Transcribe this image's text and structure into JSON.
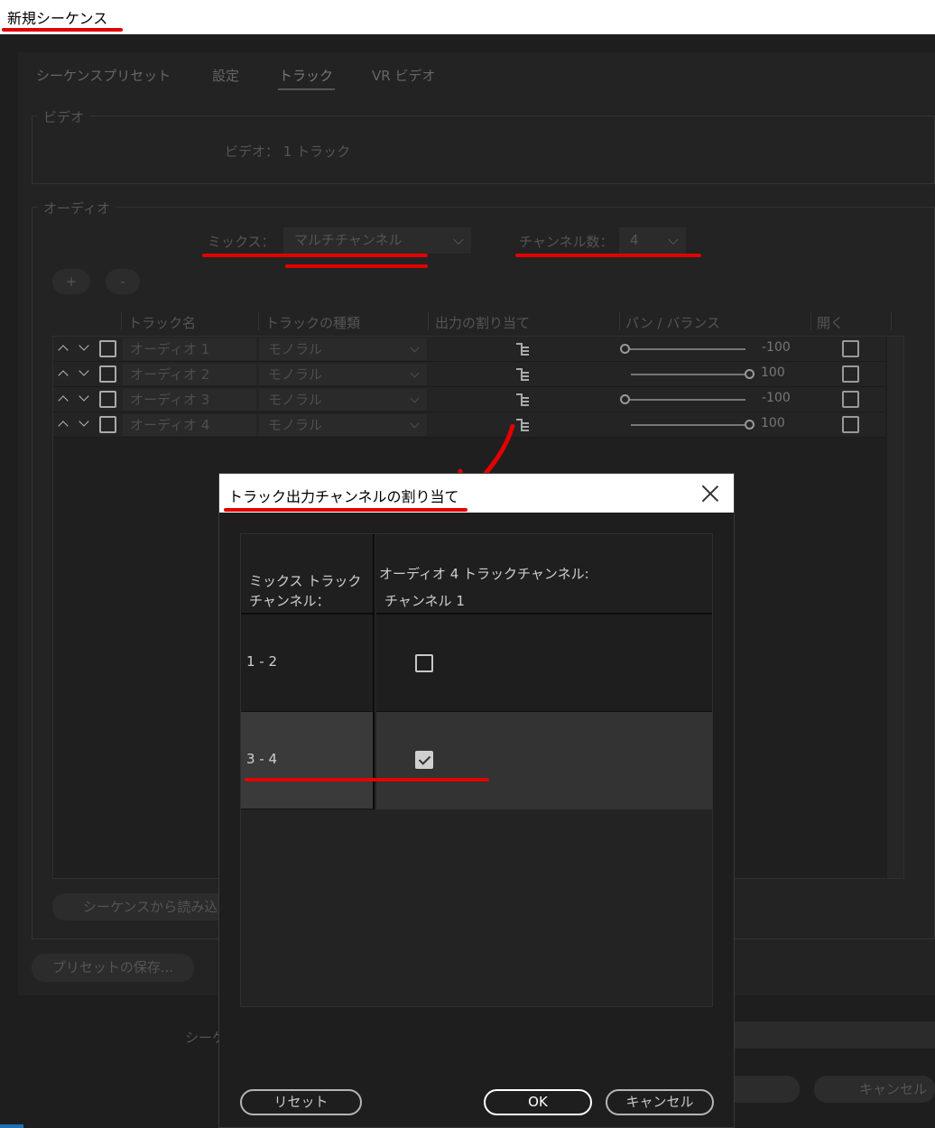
{
  "window": {
    "title": "新規シーケンス"
  },
  "tabs": [
    {
      "label": "シーケンスプリセット"
    },
    {
      "label": "設定"
    },
    {
      "label": "トラック"
    },
    {
      "label": "VR ビデオ"
    }
  ],
  "video": {
    "group_title": "ビデオ",
    "summary": "ビデオ： 1 トラック"
  },
  "audio": {
    "group_title": "オーディオ",
    "mix_label": "ミックス：",
    "mix_value": "マルチチャンネル",
    "channels_label": "チャンネル数：",
    "channels_value": "4",
    "add_label": "+",
    "remove_label": "-",
    "columns": [
      "トラック名",
      "トラックの種類",
      "出力の割り当て",
      "パン / バランス",
      "開く"
    ],
    "tracks": [
      {
        "name": "オーディオ 1",
        "type": "モノラル",
        "pan": "-100"
      },
      {
        "name": "オーディオ 2",
        "type": "モノラル",
        "pan": "100"
      },
      {
        "name": "オーディオ 3",
        "type": "モノラル",
        "pan": "-100"
      },
      {
        "name": "オーディオ 4",
        "type": "モノラル",
        "pan": "100"
      }
    ],
    "load_from_sequence": "シーケンスから読み込"
  },
  "footer": {
    "save_preset": "プリセットの保存...",
    "sequence_name_prefix": "シーケ",
    "cancel": "キャンセル"
  },
  "dialog": {
    "title": "トラック出力チャンネルの割り当て",
    "mix_header_line1": "ミックス トラック",
    "mix_header_line2": "チャンネル：",
    "track_header_line1": "オーディオ 4 トラックチャンネル:",
    "track_header_line2": "チャンネル 1",
    "rows": [
      {
        "label": "1 - 2",
        "checked": false
      },
      {
        "label": "3 - 4",
        "checked": true
      }
    ],
    "reset": "リセット",
    "ok": "OK",
    "cancel": "キャンセル"
  },
  "annotation_color": "#e20000"
}
